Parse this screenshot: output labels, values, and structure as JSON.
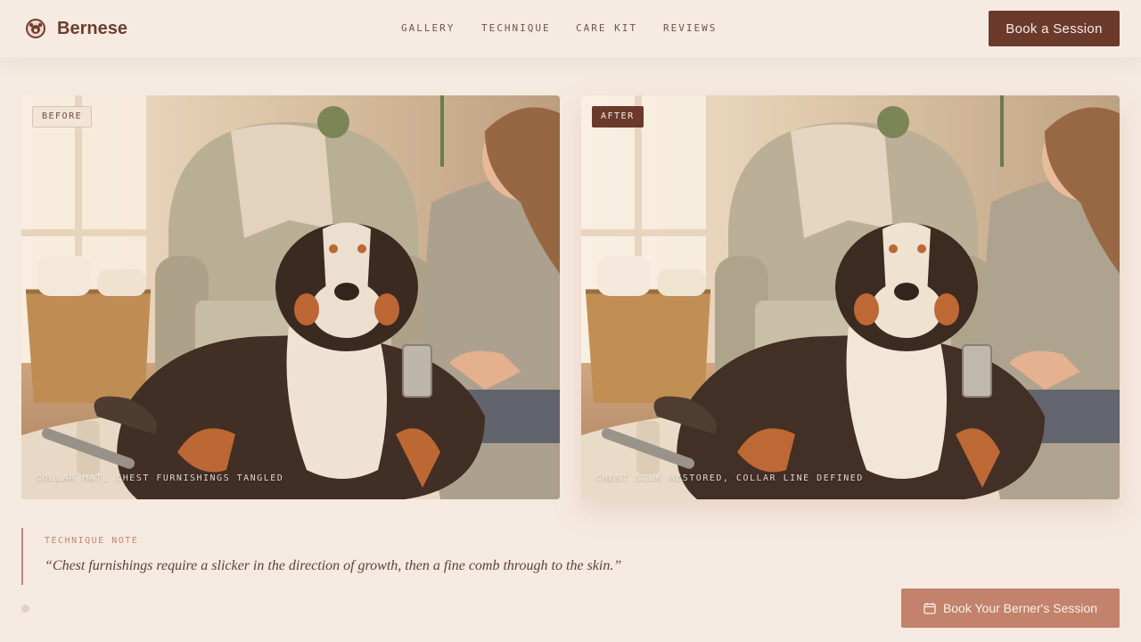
{
  "brand": {
    "name": "Bernese",
    "logo_icon": "dog-paw-logo-icon"
  },
  "nav": {
    "items": [
      "GALLERY",
      "TECHNIQUE",
      "CARE KIT",
      "REVIEWS"
    ]
  },
  "header": {
    "book_button": "Book a Session"
  },
  "comparison": {
    "before": {
      "tag": "BEFORE",
      "caption": "COLLAR MAT, CHEST FURNISHINGS TANGLED"
    },
    "after": {
      "tag": "AFTER",
      "caption": "CHEST SILK RESTORED, COLLAR LINE DEFINED"
    }
  },
  "note": {
    "label": "TECHNIQUE NOTE",
    "quote": "“Chest furnishings require a slicker in the direction of growth, then a fine comb through to the skin.”"
  },
  "cta": {
    "label": "Book Your Berner's Session",
    "icon": "calendar-icon"
  },
  "colors": {
    "background": "#f5eae1",
    "accent_dark": "#6b3a2c",
    "accent_light": "#c3826c"
  }
}
